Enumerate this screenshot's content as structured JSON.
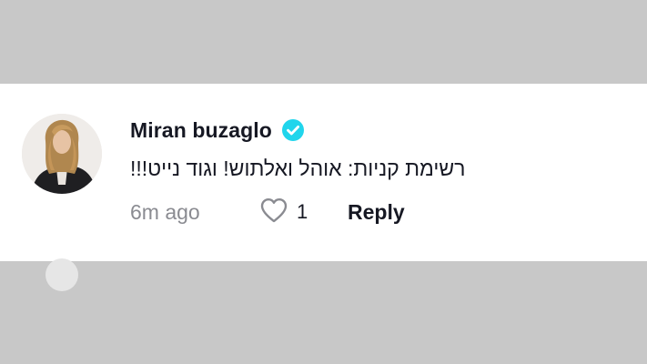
{
  "comment": {
    "username": "Miran buzaglo",
    "verified": true,
    "text": "רשימת קניות: אוהל ואלתוש! וגוד נייט!!!",
    "timestamp": "6m ago",
    "likes": "1",
    "reply_label": "Reply",
    "avatar": "avatar-photo",
    "verified_icon": "verified-badge-icon",
    "like_icon": "heart-outline-icon"
  },
  "colors": {
    "background_strip": "#c8c8c8",
    "card": "#ffffff",
    "primary_text": "#161823",
    "secondary_text": "#8a8b91",
    "verified_badge": "#20d5ec"
  }
}
